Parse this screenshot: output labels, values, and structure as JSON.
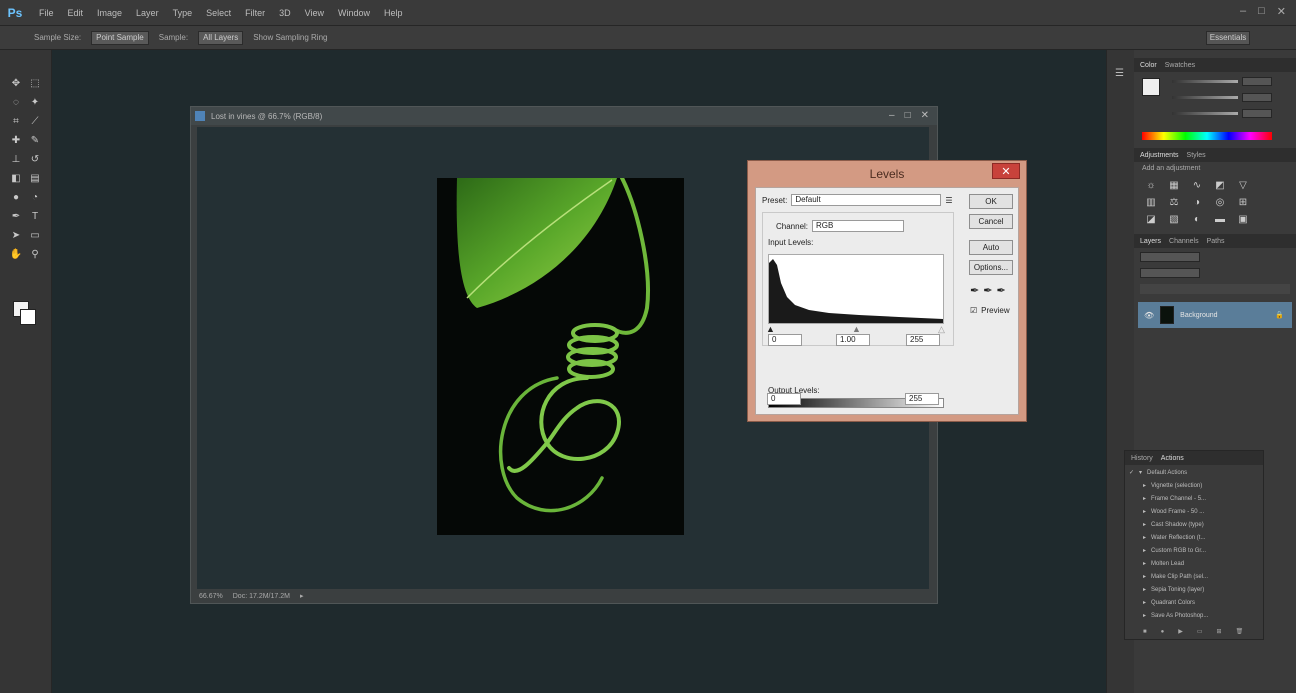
{
  "app": {
    "logo": "Ps"
  },
  "menu": [
    "File",
    "Edit",
    "Image",
    "Layer",
    "Type",
    "Select",
    "Filter",
    "3D",
    "View",
    "Window",
    "Help"
  ],
  "window_controls": [
    "–",
    "□",
    "✕"
  ],
  "options_bar": {
    "sample_size_label": "Sample Size:",
    "sample_size_value": "Point Sample",
    "sample_label": "Sample:",
    "sample_value": "All Layers",
    "show_ring_label": "Show Sampling Ring",
    "workspace": "Essentials"
  },
  "document": {
    "title": "Lost in vines @ 66.7% (RGB/8)",
    "zoom": "66.67%",
    "doc_info": "Doc: 17.2M/17.2M"
  },
  "levels": {
    "title": "Levels",
    "preset_label": "Preset:",
    "preset_value": "Default",
    "channel_label": "Channel:",
    "channel_value": "RGB",
    "input_label": "Input Levels:",
    "input_values": [
      "0",
      "1.00",
      "255"
    ],
    "output_label": "Output Levels:",
    "output_values": [
      "0",
      "255"
    ],
    "buttons": {
      "ok": "OK",
      "cancel": "Cancel",
      "auto": "Auto",
      "options": "Options..."
    },
    "preview_label": "Preview",
    "preview_checked": true
  },
  "panels": {
    "color_tabs": [
      "Color",
      "Swatches"
    ],
    "adjust_tabs": [
      "Adjustments",
      "Styles"
    ],
    "adjust_hint": "Add an adjustment",
    "layers_tabs": [
      "Layers",
      "Channels",
      "Paths"
    ],
    "layer_name": "Background",
    "actions_tabs": [
      "History",
      "Actions"
    ],
    "actions": [
      "Default Actions",
      "Vignette (selection)",
      "Frame Channel - 5...",
      "Wood Frame - 50 ...",
      "Cast Shadow (type)",
      "Water Reflection (t...",
      "Custom RGB to Gr...",
      "Molten Lead",
      "Make Clip Path (sel...",
      "Sepia Toning (layer)",
      "Quadrant Colors",
      "Save As Photoshop..."
    ]
  }
}
